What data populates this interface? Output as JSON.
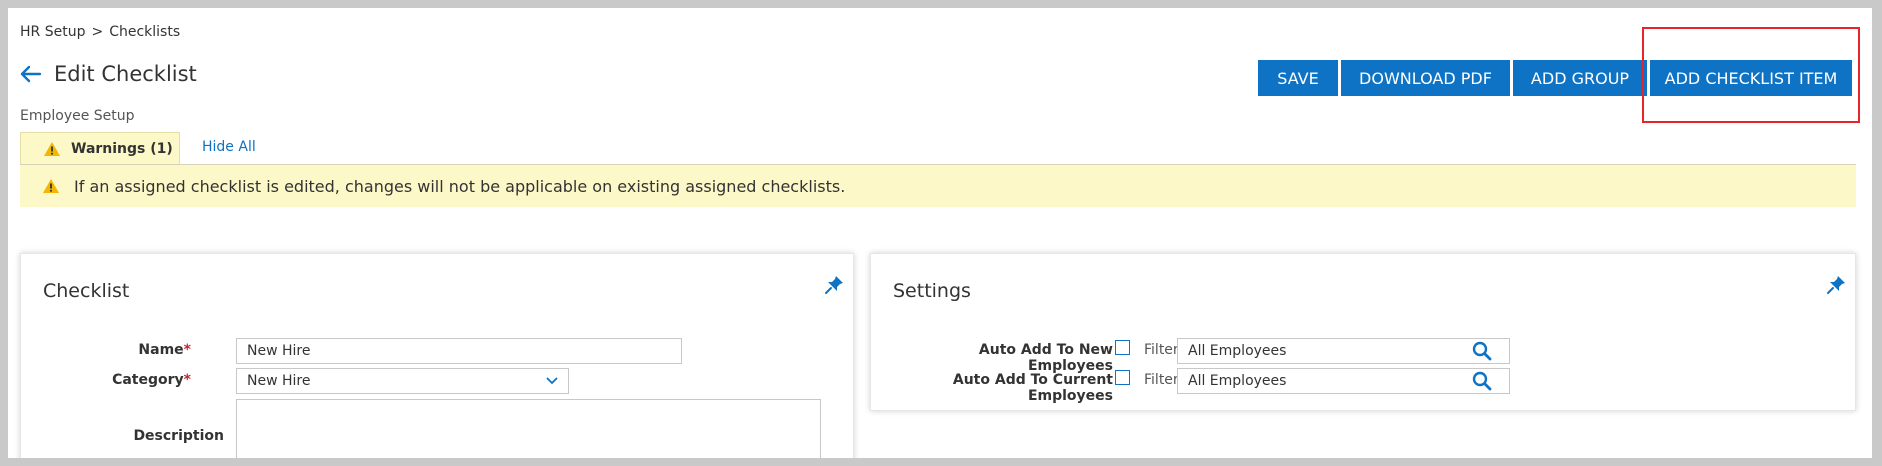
{
  "breadcrumb": {
    "root": "HR Setup",
    "separator": ">",
    "current": "Checklists"
  },
  "header": {
    "back_icon": "arrow-left-icon",
    "title": "Edit Checklist",
    "subtitle": "Employee Setup"
  },
  "toolbar": {
    "save": "SAVE",
    "download_pdf": "DOWNLOAD PDF",
    "add_group": "ADD GROUP",
    "add_checklist_item": "ADD CHECKLIST ITEM"
  },
  "warnings": {
    "tab_label": "Warnings (1)",
    "hide_all": "Hide All",
    "message": "If an assigned checklist is edited, changes will not be applicable on existing assigned checklists."
  },
  "checklist_panel": {
    "title": "Checklist",
    "name_label": "Name",
    "name_value": "New Hire",
    "category_label": "Category",
    "category_value": "New Hire",
    "description_label": "Description",
    "required_mark": "*"
  },
  "settings_panel": {
    "title": "Settings",
    "auto_new_label": "Auto Add To New Employees",
    "auto_current_label": "Auto Add To Current Employees",
    "filter_label": "Filter",
    "filter_new_value": "All Employees",
    "filter_current_value": "All Employees"
  },
  "colors": {
    "primary": "#0e73c4",
    "warning_bg": "#fdf8c8",
    "highlight": "#e5252a",
    "required": "#c0262d"
  }
}
